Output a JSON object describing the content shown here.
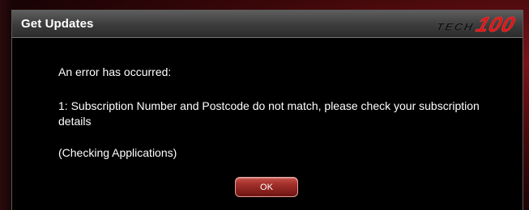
{
  "dialog": {
    "title": "Get Updates",
    "logo": {
      "prefix": "TECH",
      "number": "100"
    },
    "message": {
      "heading": "An error has occurred:",
      "detail": "1: Subscription Number and Postcode do not match, please check your subscription details",
      "context": "(Checking Applications)"
    },
    "ok_label": "OK"
  },
  "colors": {
    "accent": "#d81818",
    "dialog_background": "#000000",
    "titlebar": "#3e3e3e",
    "button": "#a2302b"
  }
}
